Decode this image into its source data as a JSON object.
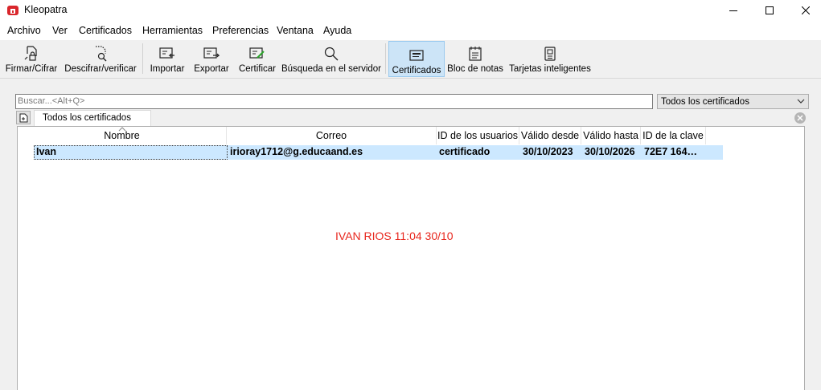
{
  "window": {
    "title": "Kleopatra"
  },
  "menu": [
    "Archivo",
    "Ver",
    "Certificados",
    "Herramientas",
    "Preferencias",
    "Ventana",
    "Ayuda"
  ],
  "toolbar": {
    "sign": "Firmar/Cifrar",
    "decrypt": "Descifrar/verificar",
    "import": "Importar",
    "export": "Exportar",
    "certify": "Certificar",
    "server_search": "Búsqueda en el servidor",
    "certificates": "Certificados",
    "notepad": "Bloc de notas",
    "smartcards": "Tarjetas inteligentes"
  },
  "search": {
    "placeholder": "Buscar...<Alt+Q>",
    "value": ""
  },
  "filter": {
    "selected": "Todos los certificados"
  },
  "tab": {
    "label": "Todos los certificados"
  },
  "table": {
    "columns": [
      "Nombre",
      "Correo",
      "ID de los usuarios",
      "Válido desde",
      "Válido hasta",
      "ID de la clave"
    ],
    "rows": [
      {
        "name": "Ivan",
        "email": "irioray1712@g.educaand.es",
        "user_id": "certificado",
        "valid_from": "30/10/2023",
        "valid_to": "30/10/2026",
        "key_id": "72E7 164…"
      }
    ]
  },
  "overlay_text": "IVAN RIOS 11:04 30/10",
  "colors": {
    "selection": "#cce8ff",
    "active_tool": "#cce4f7",
    "overlay": "#e8271e"
  }
}
